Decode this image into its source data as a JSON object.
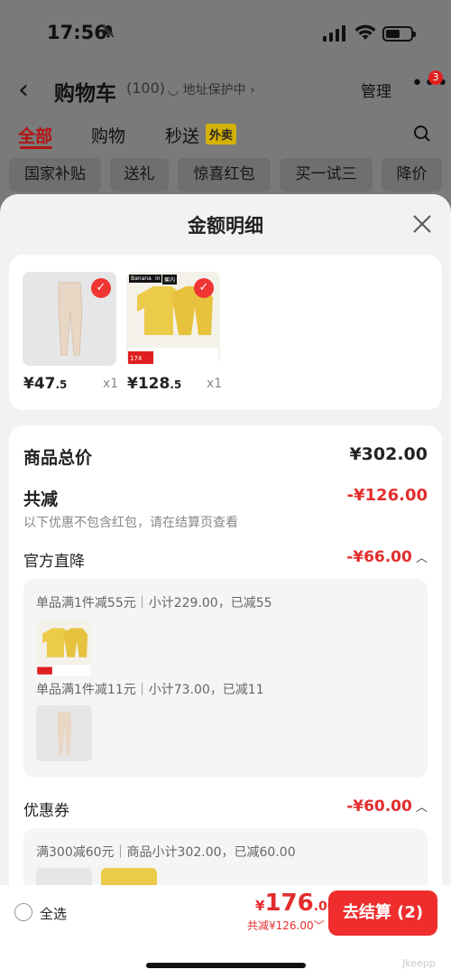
{
  "status": {
    "time": "17:56"
  },
  "header": {
    "title": "购物车",
    "count": "(100)",
    "address": "地址保护中",
    "manage": "管理",
    "more_badge": "3"
  },
  "tabs": [
    {
      "label": "全部"
    },
    {
      "label": "购物"
    },
    {
      "label": "秒送"
    }
  ],
  "tab_tag": "外卖",
  "chips": [
    "国家补贴",
    "送礼",
    "惊喜红包",
    "买一试三",
    "降价"
  ],
  "sheet": {
    "title": "金额明细"
  },
  "products": [
    {
      "price_int": "¥47",
      "price_dec": ".5",
      "qty": "x1"
    },
    {
      "price_int": "¥128",
      "price_dec": ".5",
      "qty": "x1"
    }
  ],
  "product_image_text": {
    "brand": "Banana",
    "badge_in": "in",
    "badge_tag": "蕉内",
    "price_tag": "174"
  },
  "summary": {
    "total_label": "商品总价",
    "total_value": "¥302.00",
    "discount_label": "共减",
    "discount_value": "-¥126.00",
    "discount_hint": "以下优惠不包含红包，请在结算页查看"
  },
  "official": {
    "label": "官方直降",
    "value": "-¥66.00",
    "rules": [
      "单品满1件减55元｜小计229.00，已减55",
      "单品满1件减11元｜小计73.00，已减11"
    ]
  },
  "coupon": {
    "label": "优惠券",
    "value": "-¥60.00",
    "rule": "满300减60元｜商品小计302.00，已减60.00"
  },
  "bottom": {
    "select_all": "全选",
    "currency": "¥",
    "total_int": "176",
    "total_dec": ".00",
    "saved": "共减¥126.00",
    "checkout": "去结算 (2)"
  },
  "watermark": "Jkeepp",
  "colors": {
    "accent_red": "#e32d2d",
    "tab_active": "#b41414",
    "tag_yellow": "#d4b100",
    "pants_beige": "#e9d7c6",
    "pajama_yellow": "#eccb4a"
  }
}
